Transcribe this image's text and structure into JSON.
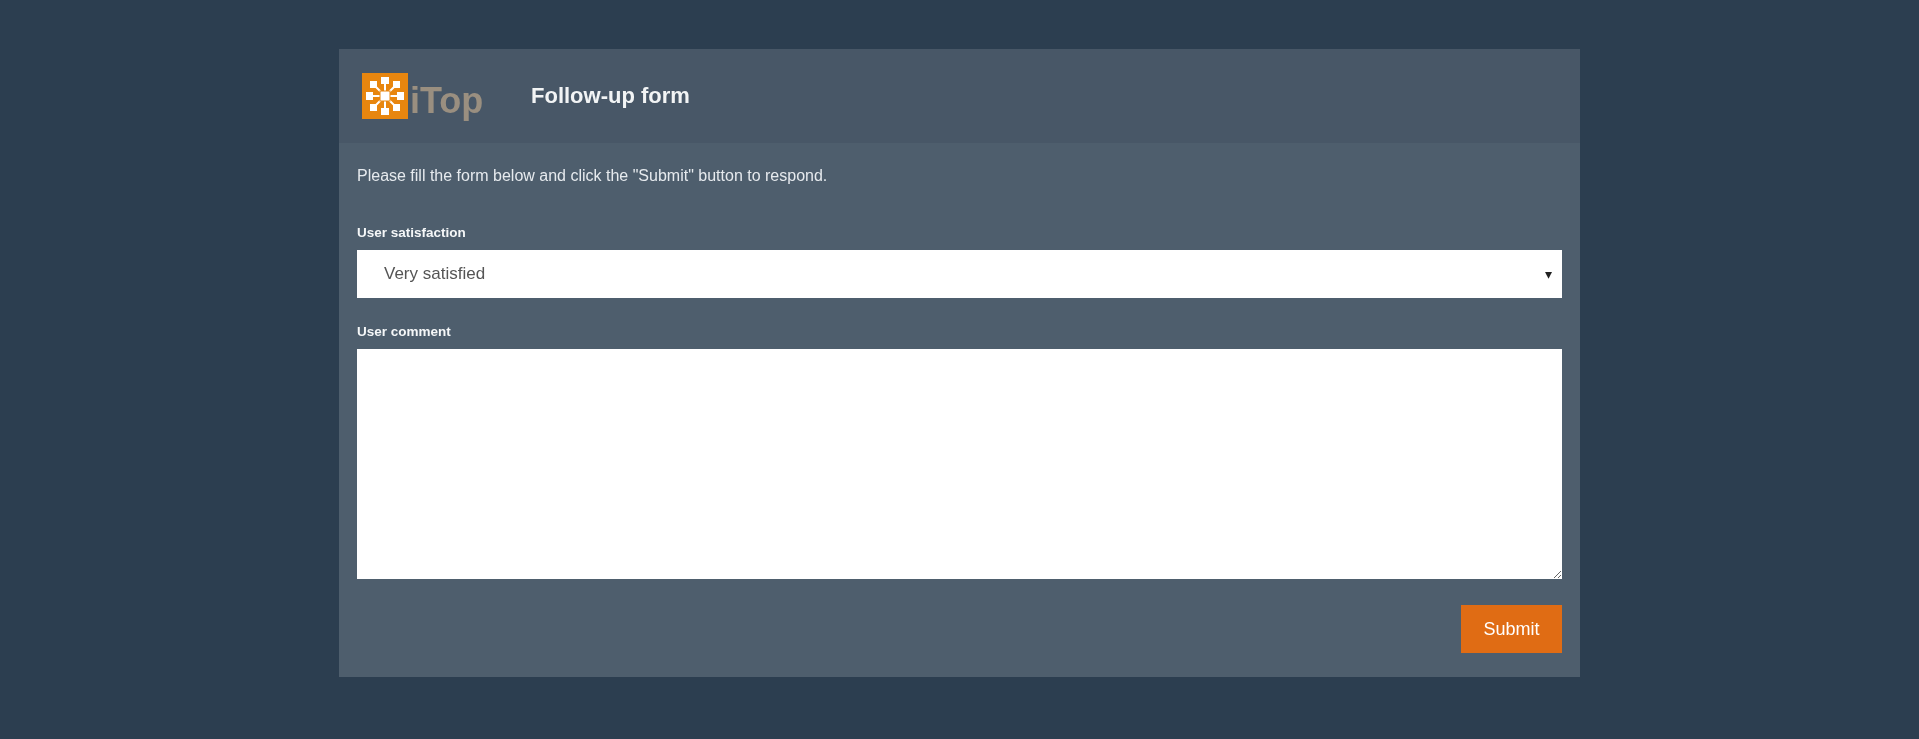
{
  "header": {
    "logo_text": "iTop",
    "title": "Follow-up form"
  },
  "intro": "Please fill the form below and click the \"Submit\" button to respond.",
  "fields": [
    {
      "kind": "select",
      "label": "User satisfaction",
      "value": "Very satisfied",
      "arrow": "▾"
    },
    {
      "kind": "textarea",
      "label": "User comment"
    }
  ],
  "buttons": [
    {
      "label": "Submit"
    }
  ]
}
